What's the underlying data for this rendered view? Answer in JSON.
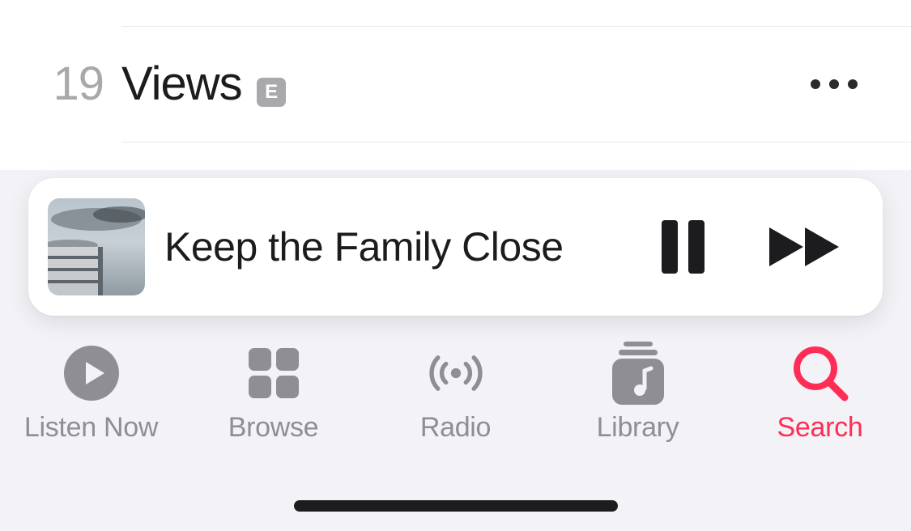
{
  "track": {
    "number": "19",
    "title": "Views",
    "explicit": "E"
  },
  "nowPlaying": {
    "title": "Keep the Family Close"
  },
  "tabs": {
    "listenNow": "Listen Now",
    "browse": "Browse",
    "radio": "Radio",
    "library": "Library",
    "search": "Search"
  },
  "colors": {
    "accent": "#ff2d55",
    "inactive": "#8e8e93"
  }
}
